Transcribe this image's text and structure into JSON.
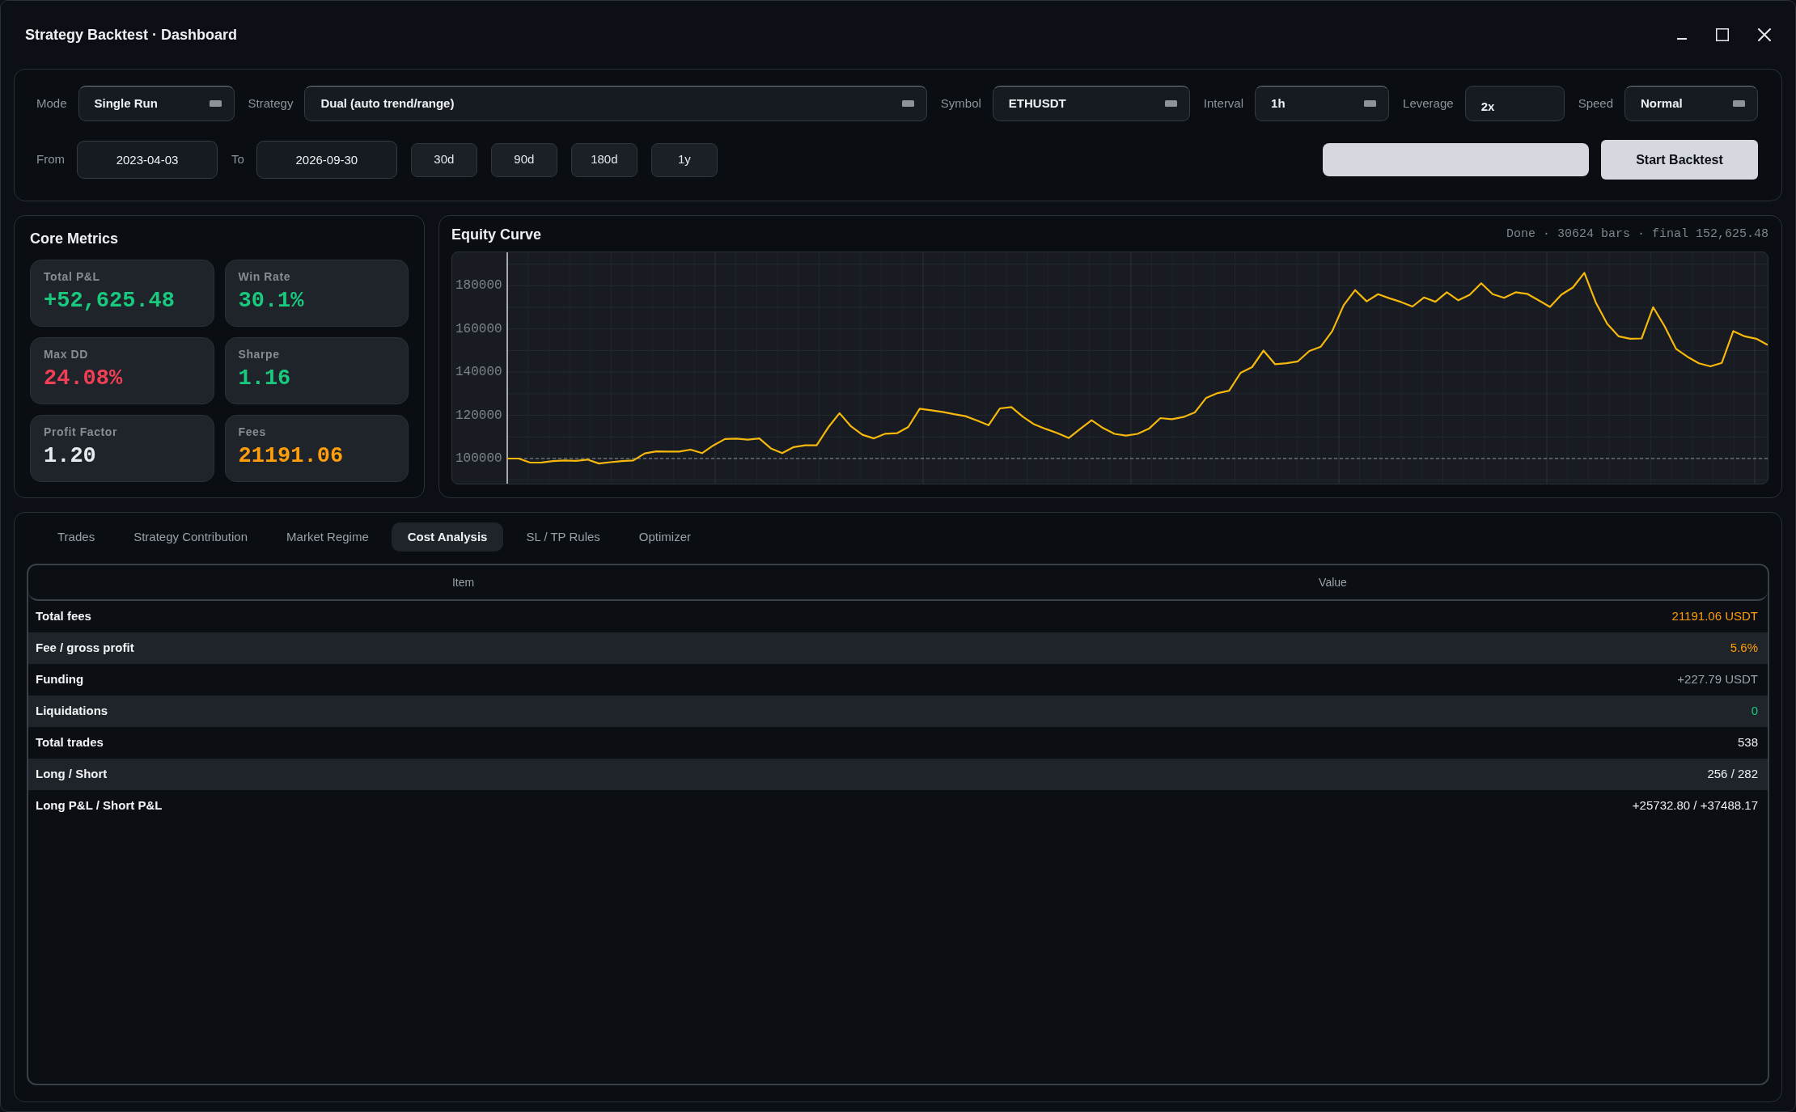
{
  "window": {
    "title": "Strategy Backtest · Dashboard"
  },
  "controls": {
    "fields": [
      {
        "kind": "select",
        "label": "Mode",
        "value": "Single Run"
      },
      {
        "kind": "select",
        "label": "Strategy",
        "value": "Dual (auto trend/range)"
      },
      {
        "kind": "select",
        "label": "Symbol",
        "value": "ETHUSDT"
      },
      {
        "kind": "select",
        "label": "Interval",
        "value": "1h"
      },
      {
        "kind": "input",
        "label": "Leverage",
        "value": "2x"
      },
      {
        "kind": "select",
        "label": "Speed",
        "value": "Normal"
      }
    ],
    "dates": [
      {
        "label": "From",
        "value": "2023-04-03"
      },
      {
        "label": "To",
        "value": "2026-09-30"
      }
    ],
    "presets": [
      "30d",
      "90d",
      "180d",
      "1y"
    ],
    "progress": {
      "level": 1
    },
    "start_button": "Start Backtest"
  },
  "metrics": {
    "title": "Core Metrics",
    "items": [
      {
        "label": "Total P&L",
        "value": "+52,625.48",
        "color": "#19c97e"
      },
      {
        "label": "Win Rate",
        "value": "30.1%",
        "color": "#19c97e"
      },
      {
        "label": "Max DD",
        "value": "24.08%",
        "color": "#f23f55"
      },
      {
        "label": "Sharpe",
        "value": "1.16",
        "color": "#19c97e"
      },
      {
        "label": "Profit Factor",
        "value": "1.20",
        "color": "#e8eaee"
      },
      {
        "label": "Fees",
        "value": "21191.06",
        "color": "#ff9d0b"
      }
    ]
  },
  "equity": {
    "status": "Done · 30624 bars · final 152,625.48",
    "chart_data": {
      "type": "line",
      "title": "Equity Curve",
      "ylim": [
        88000,
        195500
      ],
      "yticks": [
        100000,
        120000,
        140000,
        160000,
        180000
      ],
      "grid": true,
      "categories": [
        null,
        null,
        null,
        null,
        null,
        null,
        null,
        null,
        null,
        null,
        null,
        null,
        null,
        null,
        null,
        null,
        null,
        null,
        null,
        null,
        null,
        null,
        null,
        null,
        null,
        null,
        null,
        null,
        null,
        null,
        null,
        null,
        null,
        null,
        null,
        null,
        null,
        null,
        null,
        null,
        null,
        null,
        null,
        null,
        null,
        null,
        null,
        null,
        null,
        null,
        null,
        null,
        null,
        null,
        null,
        null,
        null,
        null,
        null,
        null,
        null,
        null,
        null,
        null,
        null,
        null,
        null,
        null,
        null,
        null,
        null,
        null,
        null,
        null,
        null,
        null,
        null,
        null,
        null,
        null,
        null,
        null,
        null,
        null,
        null,
        null,
        null,
        null,
        null,
        null,
        null,
        null,
        null,
        null,
        null,
        null,
        null,
        null,
        null,
        null,
        null,
        null,
        null,
        null,
        null,
        null,
        null,
        null,
        null,
        null,
        null
      ],
      "series": [
        {
          "color": "#f5b80b",
          "values": [
            100000,
            100000,
            98100,
            98200,
            98800,
            99100,
            98900,
            99500,
            97700,
            98300,
            98800,
            99100,
            102400,
            103300,
            103200,
            103200,
            104100,
            102500,
            106100,
            109000,
            109200,
            108700,
            109300,
            104700,
            102500,
            105300,
            106100,
            106100,
            114300,
            121000,
            114900,
            111000,
            109300,
            111500,
            111700,
            114600,
            123100,
            122300,
            121600,
            120500,
            119600,
            117600,
            115400,
            123200,
            123800,
            119300,
            115800,
            113700,
            111800,
            109500,
            113700,
            117700,
            114100,
            111400,
            110600,
            111400,
            113800,
            118700,
            118200,
            119200,
            121300,
            128100,
            130300,
            131400,
            139700,
            142300,
            150000,
            143700,
            144100,
            145000,
            149800,
            151800,
            159000,
            171000,
            178000,
            172800,
            176100,
            174200,
            172500,
            170400,
            174600,
            172600,
            177000,
            173300,
            175800,
            181200,
            176100,
            174400,
            177000,
            176300,
            173300,
            170200,
            175900,
            179200,
            186000,
            172300,
            162300,
            156600,
            155500,
            155600,
            170100,
            161300,
            150800,
            147100,
            144100,
            142700,
            144300,
            159000,
            156600,
            155500,
            152600
          ]
        }
      ],
      "ref_lines": [
        {
          "axis": "y",
          "value": 100000
        }
      ]
    }
  },
  "tabs": [
    {
      "label": "Trades",
      "selected": false
    },
    {
      "label": "Strategy Contribution",
      "selected": false
    },
    {
      "label": "Market Regime",
      "selected": false
    },
    {
      "label": "Cost Analysis",
      "selected": true
    },
    {
      "label": "SL / TP Rules",
      "selected": false
    },
    {
      "label": "Optimizer",
      "selected": false
    }
  ],
  "table": {
    "columns": [
      "Item",
      "Value"
    ],
    "rows": [
      {
        "item": "Total fees",
        "value": "21191.06 USDT",
        "color": "#ff9d0b"
      },
      {
        "item": "Fee / gross profit",
        "value": "5.6%",
        "color": "#ff9d0b"
      },
      {
        "item": "Funding",
        "value": "+227.79 USDT",
        "color": "#9ba1aa"
      },
      {
        "item": "Liquidations",
        "value": "0",
        "color": "#19c97e"
      },
      {
        "item": "Total trades",
        "value": "538",
        "color": "#eceef1"
      },
      {
        "item": "Long / Short",
        "value": "256 / 282",
        "color": "#eceef1"
      },
      {
        "item": "Long P&L / Short P&L",
        "value": "+25732.80 / +37488.17",
        "color": "#eceef1"
      }
    ]
  }
}
